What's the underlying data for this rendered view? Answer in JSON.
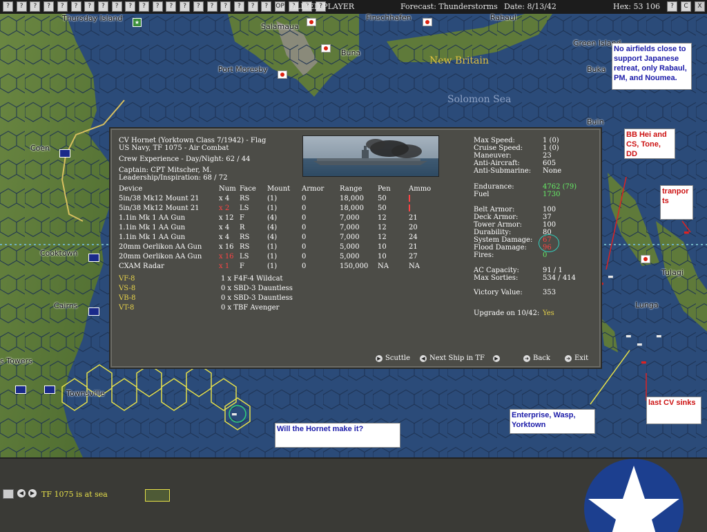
{
  "topbar": {
    "buttons": [
      "?",
      "?",
      "?",
      "?",
      "?",
      "?",
      "?",
      "?",
      "?",
      "?",
      "?",
      "?",
      "?",
      "?",
      "?",
      "?",
      "?",
      "?",
      "?",
      "?",
      "OP",
      "?",
      "?",
      "?"
    ],
    "player": "ALLIED PLAYER",
    "forecast": "Forecast: Thunderstorms",
    "date": "Date: 8/13/42",
    "hex": "Hex: 53 106",
    "right_buttons": [
      "?",
      "C",
      "X"
    ]
  },
  "map": {
    "places": {
      "thursday_island": "Thursday Island",
      "salamaua": "Salamaua",
      "finschhafen": "Finschhafen",
      "rabaul": "Rabaul",
      "green_island": "Green Island",
      "buna": "Buna",
      "port_moresby": "Port Moresby",
      "buka": "Buka",
      "buin": "Buin",
      "coen": "Coen",
      "cooktown": "Cooktown",
      "cairns": "Cairns",
      "towers": "s Towers",
      "townsville": "Townsville",
      "tulagi": "Tulagi",
      "lunga": "Lunga"
    },
    "regions": {
      "new_britain": "New Britain",
      "solomon_sea": "Solomon Sea"
    },
    "annotations": {
      "airfields": "No airfields close to support Japanese retreat, only Rabaul, PM, and Noumea.",
      "bb_hei": "BB Hei and CS, Tone, DD",
      "transports": "tranports",
      "hornet": "Will the Hornet make it?",
      "enterprise": "Enterprise, Wasp, Yorktown",
      "last_cv": "last CV sinks"
    },
    "colors": {
      "sea": "#2a4a78",
      "land": "#5f7a3a",
      "note_red": "#cc1111",
      "note_blue": "#1a1aa8"
    }
  },
  "ship": {
    "name_line": "CV Hornet (Yorktown Class 7/1942) - Flag",
    "navy_line": "US Navy, TF 1075 - Air Combat",
    "crew_exp": "Crew Experience - Day/Night: 62 / 44",
    "captain": "Captain: CPT Mitscher, M.",
    "leadership": "Leadership/Inspiration: 68 / 72",
    "device_headers": [
      "Device",
      "Num",
      "Face",
      "Mount",
      "Armor",
      "Range",
      "Pen",
      "Ammo"
    ],
    "devices": [
      {
        "name": "5in/38 Mk12 Mount 21",
        "num": "x 4",
        "face": "RS",
        "mount": "(1)",
        "armor": "0",
        "range": "18,000",
        "pen": "50",
        "ammo": "",
        "num_red": false,
        "ammo_red": true
      },
      {
        "name": "5in/38 Mk12 Mount 21",
        "num": "x 2",
        "face": "LS",
        "mount": "(1)",
        "armor": "0",
        "range": "18,000",
        "pen": "50",
        "ammo": "",
        "num_red": true,
        "ammo_red": true
      },
      {
        "name": "1.1in Mk 1 AA Gun",
        "num": "x 12",
        "face": "F",
        "mount": "(4)",
        "armor": "0",
        "range": "7,000",
        "pen": "12",
        "ammo": "21",
        "num_red": false,
        "ammo_red": false
      },
      {
        "name": "1.1in Mk 1 AA Gun",
        "num": "x 4",
        "face": "R",
        "mount": "(4)",
        "armor": "0",
        "range": "7,000",
        "pen": "12",
        "ammo": "20",
        "num_red": false,
        "ammo_red": false
      },
      {
        "name": "1.1in Mk 1 AA Gun",
        "num": "x 4",
        "face": "RS",
        "mount": "(4)",
        "armor": "0",
        "range": "7,000",
        "pen": "12",
        "ammo": "24",
        "num_red": false,
        "ammo_red": false
      },
      {
        "name": "20mm Oerlikon AA Gun",
        "num": "x 16",
        "face": "RS",
        "mount": "(1)",
        "armor": "0",
        "range": "5,000",
        "pen": "10",
        "ammo": "21",
        "num_red": false,
        "ammo_red": false
      },
      {
        "name": "20mm Oerlikon AA Gun",
        "num": "x 16",
        "face": "LS",
        "mount": "(1)",
        "armor": "0",
        "range": "5,000",
        "pen": "10",
        "ammo": "27",
        "num_red": true,
        "ammo_red": false
      },
      {
        "name": "CXAM Radar",
        "num": "x 1",
        "face": "F",
        "mount": "(1)",
        "armor": "0",
        "range": "150,000",
        "pen": "NA",
        "ammo": "NA",
        "num_red": true,
        "ammo_red": false
      }
    ],
    "air_groups": [
      {
        "unit": "VF-8",
        "aircraft": "1 x F4F-4 Wildcat"
      },
      {
        "unit": "VS-8",
        "aircraft": "0 x SBD-3 Dauntless"
      },
      {
        "unit": "VB-8",
        "aircraft": "0 x SBD-3 Dauntless"
      },
      {
        "unit": "VT-8",
        "aircraft": "0 x TBF Avenger"
      }
    ],
    "stats_a": [
      {
        "label": "Max Speed:",
        "value": "1 (0)",
        "color": "#ffffff"
      },
      {
        "label": "Cruise Speed:",
        "value": "1 (0)",
        "color": "#ffffff"
      },
      {
        "label": "Maneuver:",
        "value": "23",
        "color": "#ffffff"
      },
      {
        "label": "Anti-Aircraft:",
        "value": "605",
        "color": "#ffffff"
      },
      {
        "label": "Anti-Submarine:",
        "value": "None",
        "color": "#ffffff"
      }
    ],
    "stats_b": [
      {
        "label": "Endurance:",
        "value": "4762 (79)",
        "color": "#66ee66"
      },
      {
        "label": "Fuel",
        "value": "1730",
        "color": "#66ee66"
      }
    ],
    "stats_c": [
      {
        "label": "Belt Armor:",
        "value": "100",
        "color": "#ffffff"
      },
      {
        "label": "Deck Armor:",
        "value": "37",
        "color": "#ffffff"
      },
      {
        "label": "Tower Armor:",
        "value": "100",
        "color": "#ffffff"
      },
      {
        "label": "Durability:",
        "value": "80",
        "color": "#ffffff"
      },
      {
        "label": "System Damage:",
        "value": "67",
        "color": "#ff4444"
      },
      {
        "label": "Flood Damage:",
        "value": "96",
        "color": "#ff4444"
      },
      {
        "label": "Fires:",
        "value": "0",
        "color": "#66ee66"
      }
    ],
    "stats_d": [
      {
        "label": "AC Capacity:",
        "value": "91 / 1",
        "color": "#ffffff"
      },
      {
        "label": "Max Sorties:",
        "value": "534 / 414",
        "color": "#ffffff"
      }
    ],
    "victory": {
      "label": "Victory Value:",
      "value": "353"
    },
    "upgrade": {
      "label": "Upgrade on 10/42:",
      "value": "Yes"
    },
    "nav": {
      "scuttle": "Scuttle",
      "next_ship": "Next Ship in TF",
      "back": "Back",
      "exit": "Exit"
    }
  },
  "bottombar": {
    "status": "TF 1075 is at sea"
  }
}
